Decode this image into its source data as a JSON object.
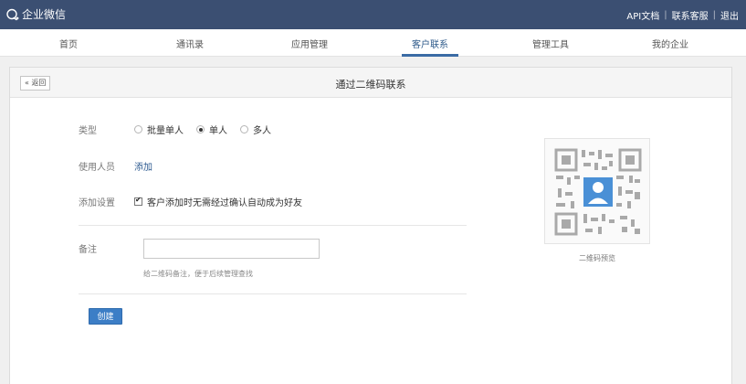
{
  "header": {
    "app_name": "企业微信",
    "links": [
      "API文档",
      "联系客服",
      "退出"
    ]
  },
  "nav": {
    "items": [
      "首页",
      "通讯录",
      "应用管理",
      "客户联系",
      "管理工具",
      "我的企业"
    ],
    "active_index": 3
  },
  "page": {
    "back_label": "« 返回",
    "title": "通过二维码联系"
  },
  "form": {
    "type_label": "类型",
    "type_options": [
      "批量单人",
      "单人",
      "多人"
    ],
    "type_selected": "单人",
    "user_label": "使用人员",
    "add_link": "添加",
    "settings_label": "添加设置",
    "auto_accept_text": "客户添加时无需经过确认自动成为好友",
    "auto_accept_checked": true,
    "note_label": "备注",
    "note_value": "",
    "note_hint": "给二维码备注，便于后续管理查找",
    "create_button": "创建"
  },
  "preview": {
    "caption": "二维码预览"
  },
  "colors": {
    "topbar": "#3b4f72",
    "accent": "#3c7ec6",
    "link": "#2d5a90"
  }
}
